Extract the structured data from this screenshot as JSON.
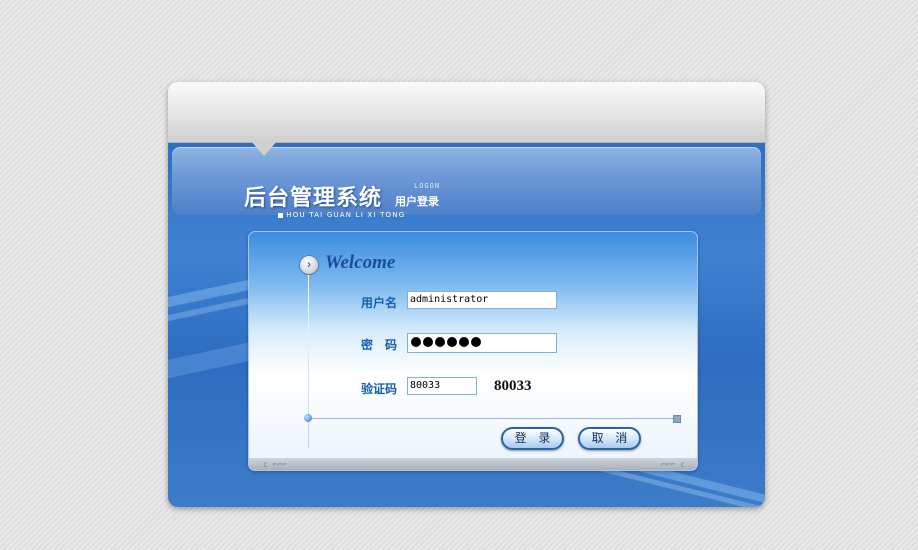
{
  "header": {
    "title": "后台管理系统",
    "subtitle": "用户登录",
    "logon_tag": "LOGON",
    "pinyin": "HOU TAI GUAN LI XI TONG"
  },
  "welcome": {
    "text": "Welcome",
    "icon": "chevron-right-circle-icon"
  },
  "form": {
    "username_label": "用户名",
    "username_value": "administrator",
    "password_label": "密　码",
    "password_value": "••••••",
    "captcha_label": "验证码",
    "captcha_value": "80033",
    "captcha_display": "80033"
  },
  "buttons": {
    "login_label": "登 录",
    "cancel_label": "取 消"
  },
  "decor": {
    "left_marks": "c ⌐⌐⌐",
    "right_marks": "⌐⌐⌐ c"
  }
}
